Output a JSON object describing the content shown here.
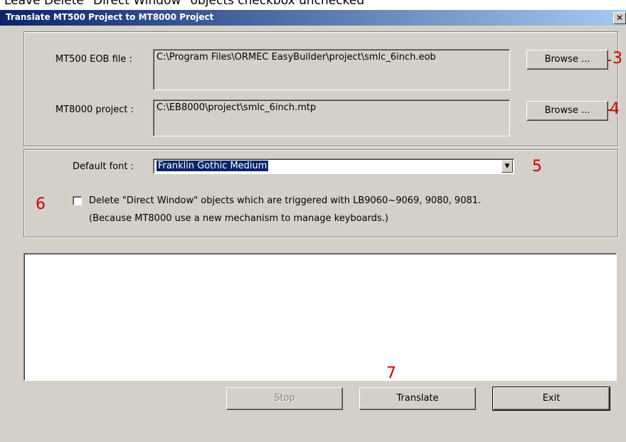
{
  "caption": "Leave Delete \"Direct Window\" objects checkbox unchecked",
  "window": {
    "title": "Translate MT500 Project to MT8000 Project",
    "close_glyph": "✕"
  },
  "files": {
    "eob_label": "MT500 EOB file :",
    "eob_value": "C:\\Program Files\\ORMEC EasyBuilder\\project\\smlc_6inch.eob",
    "project_label": "MT8000 project :",
    "project_value": "C:\\EB8000\\project\\smlc_6inch.mtp",
    "browse_label": "Browse ..."
  },
  "options": {
    "font_label": "Default font :",
    "font_value": "Franklin Gothic Medium",
    "delete_checked": false,
    "delete_text": "Delete \"Direct Window\" objects which are triggered with LB9060~9069, 9080, 9081.",
    "delete_note": "(Because MT8000 use a new mechanism to manage keyboards.)"
  },
  "buttons": {
    "stop": "Stop",
    "translate": "Translate",
    "exit": "Exit"
  },
  "annotations": {
    "n3": "3",
    "n4": "4",
    "n5": "5",
    "n6": "6",
    "n7": "7"
  },
  "colors": {
    "annotation": "#cc0000",
    "titlebar": "#0a246a",
    "dialog_bg": "#d4d0c8"
  }
}
